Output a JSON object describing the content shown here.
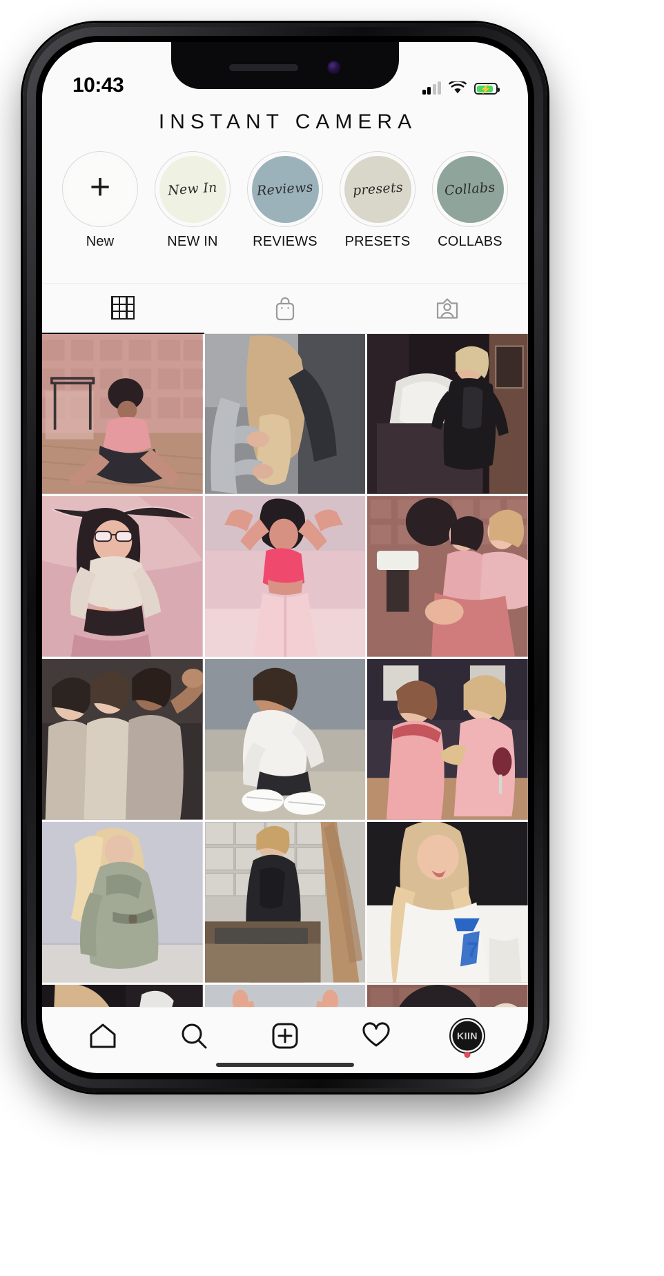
{
  "status_bar": {
    "time": "10:43",
    "signal_icon": "cellular-signal-icon",
    "wifi_icon": "wifi-icon",
    "battery_icon": "battery-charging-icon",
    "battery_level": "86"
  },
  "header": {
    "title": "INSTANT CAMERA"
  },
  "highlights": [
    {
      "label": "New",
      "script": "+",
      "disc_color": "#fbfbfa",
      "ring_color": "#d9d9d9",
      "icon": "plus-icon",
      "is_add": true
    },
    {
      "label": "NEW IN",
      "script": "New In",
      "disc_color": "#eff1e3",
      "ring_color": "#dcdcdc",
      "icon": "highlight-new-in-icon",
      "is_add": false
    },
    {
      "label": "REVIEWS",
      "script": "Reviews",
      "disc_color": "#9cb2bb",
      "ring_color": "#dcdcdc",
      "icon": "highlight-reviews-icon",
      "is_add": false
    },
    {
      "label": "PRESETS",
      "script": "presets",
      "disc_color": "#d8d7c9",
      "ring_color": "#dcdcdc",
      "icon": "highlight-presets-icon",
      "is_add": false
    },
    {
      "label": "COLLABS",
      "script": "Collabs",
      "disc_color": "#8fa59c",
      "ring_color": "#dcdcdc",
      "icon": "highlight-collabs-icon",
      "is_add": false
    }
  ],
  "profile_tabs": [
    {
      "name": "grid",
      "icon": "grid-icon",
      "active": true
    },
    {
      "name": "shop",
      "icon": "shopping-bag-icon",
      "active": false
    },
    {
      "name": "tagged",
      "icon": "tagged-photos-icon",
      "active": false
    }
  ],
  "feed": {
    "columns": 3,
    "posts": [
      {
        "id": 1,
        "alt": "woman in pink bodysuit sitting on floor in pink tiled room"
      },
      {
        "id": 2,
        "alt": "hands braiding long blonde hair from behind"
      },
      {
        "id": 3,
        "alt": "woman in black jacket holding pillow in bedroom"
      },
      {
        "id": 4,
        "alt": "woman in sunglasses and cream top against pink drapes"
      },
      {
        "id": 5,
        "alt": "woman in pink crop top and pink trousers arms raised"
      },
      {
        "id": 6,
        "alt": "two women seated by sink in pink tiled bathroom"
      },
      {
        "id": 7,
        "alt": "three friends embracing and laughing in party outfits"
      },
      {
        "id": 8,
        "alt": "woman crouching in white tee tying white sneakers outdoors"
      },
      {
        "id": 9,
        "alt": "two women laughing with pizza and wine glass"
      },
      {
        "id": 10,
        "alt": "blonde woman in trench coat with hair blowing"
      },
      {
        "id": 11,
        "alt": "man in black shirt standing by wooden planks"
      },
      {
        "id": 12,
        "alt": "woman in blue number seven jersey sticking out tongue"
      },
      {
        "id": 13,
        "alt": "close up of blonde woman winking"
      },
      {
        "id": 14,
        "alt": "woman with curly hair arms raised against pink wall"
      },
      {
        "id": 15,
        "alt": "woman by round mirror in pink tiled room"
      }
    ]
  },
  "bottom_nav": [
    {
      "name": "home",
      "icon": "home-icon"
    },
    {
      "name": "search",
      "icon": "search-icon"
    },
    {
      "name": "create",
      "icon": "plus-square-icon"
    },
    {
      "name": "activity",
      "icon": "heart-icon"
    },
    {
      "name": "profile",
      "icon": "profile-avatar",
      "avatar_text": "KIIN",
      "has_badge": true
    }
  ],
  "theme": {
    "accent": "#9cb2bb",
    "background": "#fafafa",
    "text": "#141414",
    "badge": "#e04a5a",
    "battery_green": "#4cd761"
  }
}
